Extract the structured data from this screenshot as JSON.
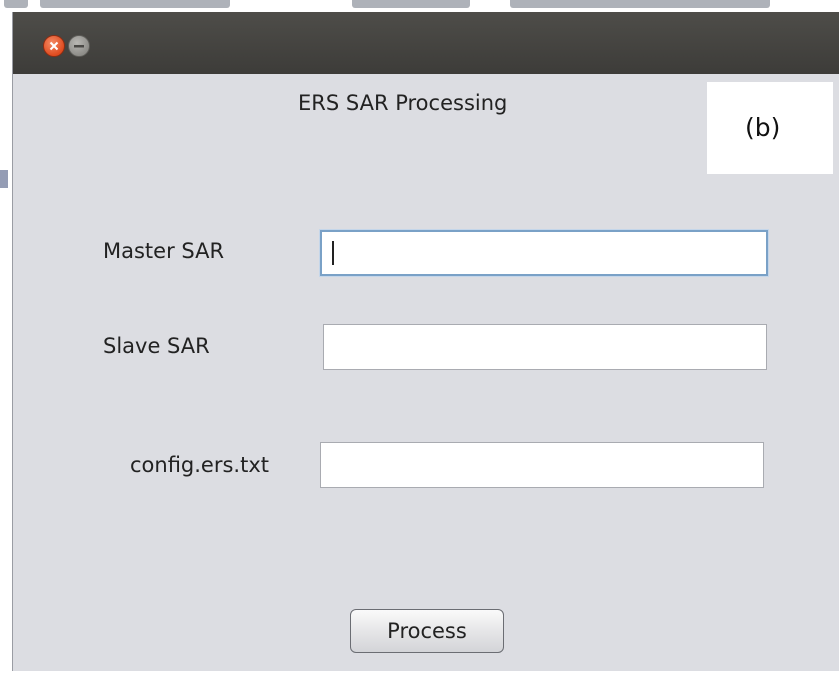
{
  "window": {
    "title": "",
    "controls": {
      "close_icon": "close-icon",
      "minimize_icon": "minimize-icon"
    },
    "colors": {
      "titlebar": "#43423f",
      "close_button": "#e4532a",
      "content_background": "#dcdde2"
    }
  },
  "form": {
    "heading": "ERS SAR Processing",
    "panel_label": "(b)",
    "fields": [
      {
        "label": "Master SAR",
        "value": "",
        "focused": true
      },
      {
        "label": "Slave SAR",
        "value": ""
      },
      {
        "label": "config.ers.txt",
        "value": ""
      }
    ],
    "process_button": "Process"
  }
}
